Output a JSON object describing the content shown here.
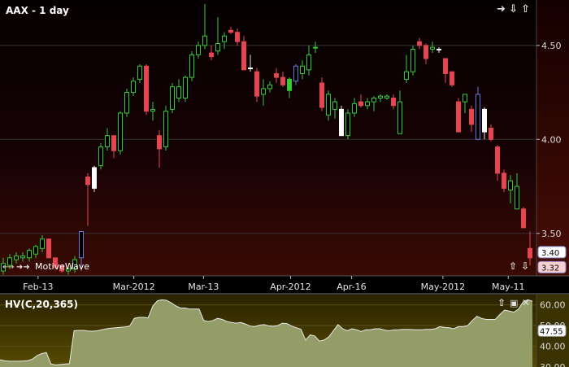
{
  "window": {
    "title": "AAX - 1 day",
    "watermark": "MotiveWave",
    "nav_icons": [
      "arrow-right-icon",
      "arrow-down-icon",
      "arrow-up-icon"
    ],
    "panel_icons": [
      "arrow-up-icon",
      "arrow-down-icon"
    ]
  },
  "colors": {
    "up_fill": "#000000",
    "up_border": "#33cc33",
    "down_fill": "#e8454f",
    "down_border": "#e8454f",
    "white_candle": "#ffffff",
    "blue_candle_border": "#6f79d6",
    "green_candle": "#33cc33",
    "grid": "#333333",
    "area_fill": "#949d68",
    "area_line": "#e8e8e8"
  },
  "chart_data": [
    {
      "type": "candlestick",
      "title": "AAX - 1 day",
      "ylim": [
        3.3,
        4.72
      ],
      "y_ticks": [
        "3.50",
        "4.00",
        "4.50"
      ],
      "x_ticks": [
        "Feb-13",
        "Mar-2012",
        "Mar-13",
        "Apr-2012",
        "Apr-16",
        "May-2012",
        "May-11"
      ],
      "price_labels": [
        {
          "text": "3.40",
          "value": 3.4
        },
        {
          "text": "3.32",
          "value": 3.32
        }
      ],
      "candles": [
        [
          3.3,
          3.37,
          3.28,
          3.34,
          "up"
        ],
        [
          3.33,
          3.39,
          3.31,
          3.37,
          "up"
        ],
        [
          3.36,
          3.4,
          3.34,
          3.38,
          "up"
        ],
        [
          3.37,
          3.4,
          3.35,
          3.38,
          "up"
        ],
        [
          3.37,
          3.42,
          3.35,
          3.41,
          "up"
        ],
        [
          3.39,
          3.44,
          3.37,
          3.43,
          "up"
        ],
        [
          3.42,
          3.49,
          3.4,
          3.47,
          "up"
        ],
        [
          3.47,
          3.44,
          3.37,
          3.37,
          "down"
        ],
        [
          3.37,
          3.37,
          3.31,
          3.32,
          "down"
        ],
        [
          3.33,
          3.33,
          3.29,
          3.3,
          "down"
        ],
        [
          3.3,
          3.33,
          3.28,
          3.31,
          "up"
        ],
        [
          3.31,
          3.38,
          3.29,
          3.36,
          "up"
        ],
        [
          3.37,
          3.42,
          3.3,
          3.51,
          "blue"
        ],
        [
          3.8,
          3.82,
          3.54,
          3.76,
          "down"
        ],
        [
          3.74,
          3.86,
          3.72,
          3.85,
          "white"
        ],
        [
          3.86,
          3.98,
          3.84,
          3.96,
          "up"
        ],
        [
          3.96,
          4.06,
          3.94,
          4.02,
          "up"
        ],
        [
          4.02,
          3.95,
          3.9,
          3.94,
          "down"
        ],
        [
          3.94,
          4.15,
          3.92,
          4.14,
          "up"
        ],
        [
          4.14,
          4.27,
          4.12,
          4.25,
          "up"
        ],
        [
          4.25,
          4.33,
          4.23,
          4.31,
          "up"
        ],
        [
          4.32,
          4.4,
          4.3,
          4.39,
          "up"
        ],
        [
          4.39,
          4.4,
          4.13,
          4.15,
          "down"
        ],
        [
          4.15,
          4.2,
          4.1,
          4.16,
          "up"
        ],
        [
          4.02,
          4.05,
          3.85,
          3.95,
          "down"
        ],
        [
          3.96,
          4.18,
          3.94,
          4.15,
          "up"
        ],
        [
          4.16,
          4.3,
          4.14,
          4.28,
          "up"
        ],
        [
          4.28,
          4.32,
          4.2,
          4.22,
          "up"
        ],
        [
          4.22,
          4.34,
          4.2,
          4.33,
          "up"
        ],
        [
          4.33,
          4.47,
          4.31,
          4.45,
          "up"
        ],
        [
          4.45,
          4.52,
          4.43,
          4.5,
          "up"
        ],
        [
          4.5,
          4.72,
          4.48,
          4.55,
          "up"
        ],
        [
          4.46,
          4.5,
          4.42,
          4.44,
          "down"
        ],
        [
          4.47,
          4.65,
          4.45,
          4.51,
          "up"
        ],
        [
          4.52,
          4.57,
          4.48,
          4.55,
          "up"
        ],
        [
          4.57,
          4.6,
          4.56,
          4.58,
          "down"
        ],
        [
          4.57,
          4.59,
          4.5,
          4.52,
          "down"
        ],
        [
          4.52,
          4.55,
          4.38,
          4.37,
          "down"
        ],
        [
          4.38,
          4.45,
          4.36,
          4.38,
          "white"
        ],
        [
          4.36,
          4.38,
          4.2,
          4.23,
          "down"
        ],
        [
          4.24,
          4.32,
          4.18,
          4.27,
          "up"
        ],
        [
          4.27,
          4.31,
          4.25,
          4.29,
          "up"
        ],
        [
          4.35,
          4.38,
          4.3,
          4.33,
          "down"
        ],
        [
          4.33,
          4.36,
          4.28,
          4.29,
          "down"
        ],
        [
          4.26,
          4.33,
          4.22,
          4.32,
          "green"
        ],
        [
          4.31,
          4.4,
          4.29,
          4.39,
          "blue"
        ],
        [
          4.39,
          4.42,
          4.32,
          4.35,
          "up"
        ],
        [
          4.45,
          4.5,
          4.34,
          4.37,
          "up"
        ],
        [
          4.49,
          4.52,
          4.46,
          4.49,
          "up"
        ],
        [
          4.3,
          4.33,
          4.15,
          4.17,
          "down"
        ],
        [
          4.13,
          4.26,
          4.1,
          4.24,
          "up"
        ],
        [
          4.16,
          4.22,
          4.11,
          4.2,
          "up"
        ],
        [
          4.16,
          4.18,
          4.02,
          4.02,
          "white"
        ],
        [
          4.02,
          4.16,
          4.0,
          4.14,
          "up"
        ],
        [
          4.14,
          4.22,
          4.12,
          4.19,
          "up"
        ],
        [
          4.2,
          4.24,
          4.17,
          4.18,
          "down"
        ],
        [
          4.18,
          4.22,
          4.16,
          4.2,
          "up"
        ],
        [
          4.2,
          4.23,
          4.15,
          4.22,
          "up"
        ],
        [
          4.22,
          4.24,
          4.2,
          4.23,
          "up"
        ],
        [
          4.23,
          4.24,
          4.21,
          4.22,
          "up"
        ],
        [
          4.22,
          4.24,
          4.16,
          4.18,
          "down"
        ],
        [
          4.2,
          4.26,
          4.1,
          4.03,
          "up"
        ],
        [
          4.32,
          4.45,
          4.3,
          4.36,
          "up"
        ],
        [
          4.36,
          4.5,
          4.34,
          4.48,
          "up"
        ],
        [
          4.52,
          4.54,
          4.48,
          4.5,
          "down"
        ],
        [
          4.5,
          4.51,
          4.4,
          4.43,
          "down"
        ],
        [
          4.48,
          4.52,
          4.46,
          4.49,
          "up"
        ],
        [
          4.48,
          4.49,
          4.46,
          4.48,
          "white"
        ],
        [
          4.43,
          4.4,
          4.3,
          4.35,
          "down"
        ],
        [
          4.36,
          4.35,
          4.28,
          4.29,
          "down"
        ],
        [
          4.2,
          4.22,
          4.05,
          4.04,
          "down"
        ],
        [
          4.2,
          4.24,
          4.14,
          4.24,
          "up"
        ],
        [
          4.16,
          4.18,
          4.04,
          4.08,
          "down"
        ],
        [
          4.24,
          4.28,
          4.03,
          4.0,
          "blue"
        ],
        [
          4.16,
          4.17,
          4.0,
          4.04,
          "white"
        ],
        [
          4.06,
          4.08,
          3.99,
          4.0,
          "down"
        ],
        [
          3.96,
          3.97,
          3.78,
          3.82,
          "down"
        ],
        [
          3.82,
          3.84,
          3.72,
          3.74,
          "down"
        ],
        [
          3.73,
          3.81,
          3.66,
          3.78,
          "up"
        ],
        [
          3.75,
          3.82,
          3.65,
          3.63,
          "up"
        ],
        [
          3.63,
          3.64,
          3.53,
          3.53,
          "down"
        ],
        [
          3.42,
          3.51,
          3.33,
          3.37,
          "down"
        ]
      ]
    },
    {
      "type": "area",
      "title": "HV(C,20,365)",
      "ylim": [
        30,
        65
      ],
      "y_ticks": [
        "30.00",
        "40.00",
        "50.00",
        "60.00"
      ],
      "last_value_label": "47.55",
      "values": [
        33.5,
        33.0,
        32.8,
        32.8,
        32.8,
        32.9,
        33.1,
        33.8,
        35.5,
        36.5,
        37.0,
        31.5,
        31.0,
        31.2,
        31.4,
        31.6,
        47.5,
        47.7,
        47.7,
        47.4,
        47.3,
        47.5,
        48.0,
        48.5,
        48.8,
        49.0,
        49.2,
        49.4,
        49.8,
        53.5,
        54.0,
        54.0,
        53.8,
        59.5,
        62.0,
        62.5,
        62.2,
        61.0,
        59.5,
        58.5,
        58.5,
        58.0,
        58.0,
        58.0,
        52.5,
        52.0,
        52.5,
        53.5,
        53.0,
        52.0,
        51.5,
        51.2,
        51.5,
        50.8,
        49.8,
        49.5,
        50.2,
        50.5,
        49.9,
        49.7,
        50.0,
        51.2,
        51.0,
        49.8,
        49.0,
        48.2,
        43.0,
        45.5,
        45.0,
        42.5,
        43.0,
        44.5,
        47.5,
        50.5,
        48.5,
        47.5,
        48.5,
        48.0,
        47.2,
        48.0,
        48.0,
        48.5,
        48.5,
        47.9,
        47.5,
        47.9,
        48.0,
        48.2,
        48.2,
        48.1,
        48.0,
        48.0,
        48.2,
        48.2,
        48.5,
        49.5,
        49.2,
        49.0,
        48.5,
        49.5,
        49.5,
        50.0,
        52.5,
        54.5,
        53.5,
        53.0,
        53.0,
        53.0,
        55.5,
        57.5,
        57.0,
        56.5,
        58.0,
        61.5,
        62.5,
        61.8
      ]
    }
  ]
}
